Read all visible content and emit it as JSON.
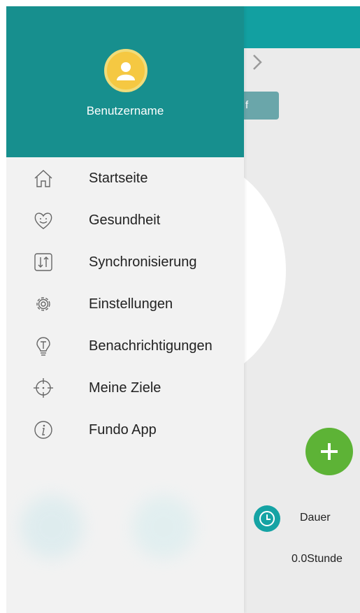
{
  "background": {
    "button_label": "f",
    "duration_label": "Dauer",
    "duration_value": "0.0Stunde",
    "fab_icon": "plus-icon",
    "clock_icon": "clock-icon",
    "chevron_icon": "chevron-right-icon"
  },
  "drawer": {
    "username": "Benutzername",
    "avatar_icon": "user-icon",
    "items": [
      {
        "label": "Startseite",
        "icon": "home-icon"
      },
      {
        "label": "Gesundheit",
        "icon": "heart-icon"
      },
      {
        "label": "Synchronisierung",
        "icon": "sync-icon"
      },
      {
        "label": "Einstellungen",
        "icon": "gear-icon"
      },
      {
        "label": "Benachrichtigungen",
        "icon": "lightbulb-icon"
      },
      {
        "label": "Meine Ziele",
        "icon": "target-icon"
      },
      {
        "label": "Fundo App",
        "icon": "info-icon"
      }
    ]
  },
  "colors": {
    "accent": "#178f8e",
    "topbar": "#12a0a1",
    "fab": "#5db336",
    "avatar": "#f5c842"
  }
}
